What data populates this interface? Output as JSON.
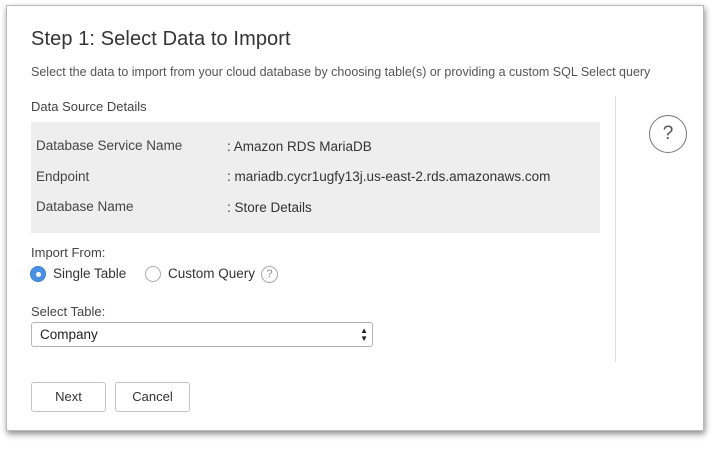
{
  "dialog": {
    "title": "Step 1: Select Data to Import",
    "subtitle": "Select the data to import from your cloud database by choosing table(s) or providing a custom SQL Select query"
  },
  "data_source": {
    "heading": "Data Source Details",
    "rows": [
      {
        "label": "Database Service Name",
        "value": ": Amazon RDS MariaDB"
      },
      {
        "label": "Endpoint",
        "value": ": mariadb.cycr1ugfy13j.us-east-2.rds.amazonaws.com"
      },
      {
        "label": "Database Name",
        "value": ": Store Details"
      }
    ]
  },
  "import_from": {
    "label": "Import From:",
    "options": [
      {
        "label": "Single Table",
        "selected": true
      },
      {
        "label": "Custom Query",
        "selected": false
      }
    ]
  },
  "select_table": {
    "label": "Select Table:",
    "value": "Company"
  },
  "buttons": {
    "next": "Next",
    "cancel": "Cancel"
  },
  "help": {
    "symbol": "?"
  },
  "colors": {
    "accent": "#4a90e2",
    "panel_bg": "#eeeeee"
  }
}
